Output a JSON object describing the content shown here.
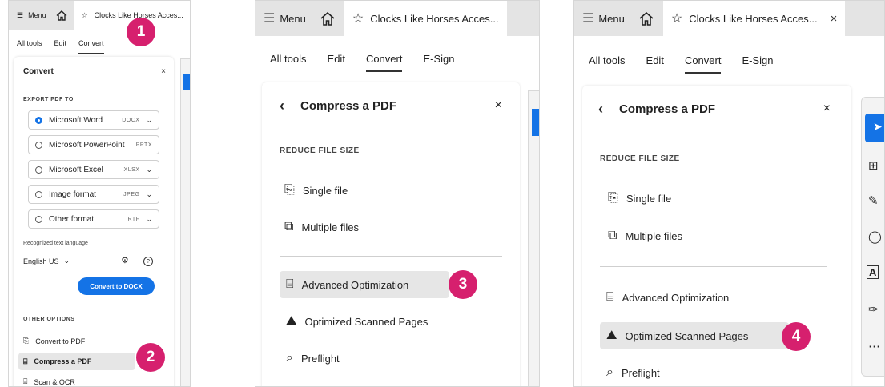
{
  "badges": [
    "1",
    "2",
    "3",
    "4"
  ],
  "panel1": {
    "menu_label": "Menu",
    "doc_tab": "Clocks Like Horses Acces...",
    "tabs": [
      "All tools",
      "Edit",
      "Convert"
    ],
    "card_title": "Convert",
    "export_label": "EXPORT PDF TO",
    "options": [
      {
        "name": "Microsoft Word",
        "format": "DOCX",
        "selected": true,
        "dropdown": true
      },
      {
        "name": "Microsoft PowerPoint",
        "format": "PPTX",
        "selected": false,
        "dropdown": false
      },
      {
        "name": "Microsoft Excel",
        "format": "XLSX",
        "selected": false,
        "dropdown": true
      },
      {
        "name": "Image format",
        "format": "JPEG",
        "selected": false,
        "dropdown": true
      },
      {
        "name": "Other format",
        "format": "RTF",
        "selected": false,
        "dropdown": true
      }
    ],
    "lang_label": "Recognized text language",
    "lang_value": "English US",
    "convert_button": "Convert to DOCX",
    "other_label": "OTHER OPTIONS",
    "other_items": [
      "Convert to PDF",
      "Compress a PDF",
      "Scan & OCR"
    ]
  },
  "panel2": {
    "menu_label": "Menu",
    "doc_tab": "Clocks Like Horses Acces...",
    "tabs": [
      "All tools",
      "Edit",
      "Convert",
      "E-Sign"
    ],
    "card_title": "Compress a PDF",
    "section_label": "REDUCE FILE SIZE",
    "items": [
      "Single file",
      "Multiple files"
    ],
    "more_items": [
      "Advanced Optimization",
      "Optimized Scanned Pages",
      "Preflight"
    ]
  },
  "panel3": {
    "menu_label": "Menu",
    "doc_tab": "Clocks Like Horses Acces...",
    "tabs": [
      "All tools",
      "Edit",
      "Convert",
      "E-Sign"
    ],
    "card_title": "Compress a PDF",
    "section_label": "REDUCE FILE SIZE",
    "items": [
      "Single file",
      "Multiple files"
    ],
    "more_items": [
      "Advanced Optimization",
      "Optimized Scanned Pages",
      "Preflight"
    ]
  },
  "colors": {
    "accent": "#1473e6",
    "badge": "#d6206e",
    "highlight": "#e6e6e6"
  }
}
